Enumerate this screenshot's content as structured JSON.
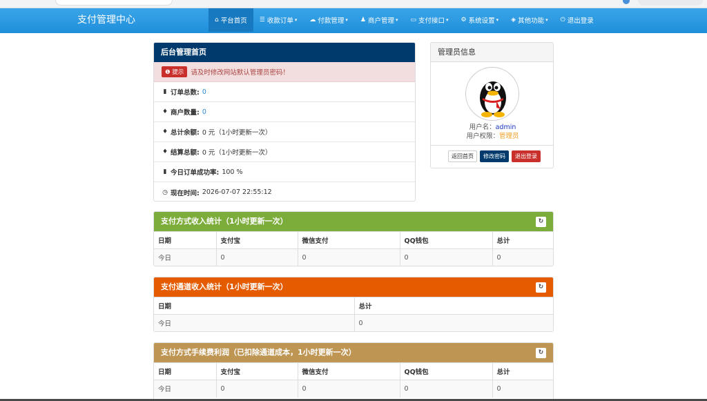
{
  "app": {
    "brand": "支付管理中心"
  },
  "nav": [
    {
      "label": "平台首页",
      "icon": "home-icon",
      "glyph": "⌂",
      "dropdown": false,
      "active": true
    },
    {
      "label": "收款订单",
      "icon": "list-icon",
      "glyph": "☰",
      "dropdown": true,
      "active": false
    },
    {
      "label": "付款管理",
      "icon": "cloud-icon",
      "glyph": "☁",
      "dropdown": true,
      "active": false
    },
    {
      "label": "商户管理",
      "icon": "user-icon",
      "glyph": "♟",
      "dropdown": true,
      "active": false
    },
    {
      "label": "支付接口",
      "icon": "credit-card-icon",
      "glyph": "▭",
      "dropdown": true,
      "active": false
    },
    {
      "label": "系统设置",
      "icon": "gear-icon",
      "glyph": "⚙",
      "dropdown": true,
      "active": false
    },
    {
      "label": "其他功能",
      "icon": "cube-icon",
      "glyph": "◈",
      "dropdown": true,
      "active": false
    },
    {
      "label": "退出登录",
      "icon": "power-icon",
      "glyph": "⏻",
      "dropdown": false,
      "active": false
    }
  ],
  "home_panel": {
    "title": "后台管理首页",
    "notice_badge": "提示",
    "notice_text": "请及时修改网站默认管理员密码！",
    "rows": [
      {
        "icon": "bar-chart-icon",
        "glyph": "▮",
        "label": "订单总数:",
        "value": "0",
        "link": true
      },
      {
        "icon": "drop-icon",
        "glyph": "♦",
        "label": "商户数量:",
        "value": "0",
        "link": true
      },
      {
        "icon": "drop-icon",
        "glyph": "♦",
        "label": "总计余额:",
        "value": "0 元（1小时更新一次）",
        "link": false
      },
      {
        "icon": "drop-icon",
        "glyph": "♦",
        "label": "结算总额:",
        "value": "0 元（1小时更新一次）",
        "link": false
      },
      {
        "icon": "bar-chart-icon",
        "glyph": "▮",
        "label": "今日订单成功率:",
        "value": "100 %",
        "link": false
      },
      {
        "icon": "clock-icon",
        "glyph": "◷",
        "label": "现在时间:",
        "value": "2026-07-07 22:55:12",
        "link": false
      }
    ]
  },
  "admin_panel": {
    "title": "管理员信息",
    "username_label": "用户名：",
    "username": "admin",
    "role_label": "用户权限：",
    "role": "管理员",
    "btn_home": "返回首页",
    "btn_password": "修改密码",
    "btn_logout": "退出登录"
  },
  "method_stats": {
    "title": "支付方式收入统计（1小时更新一次）",
    "headers": [
      "日期",
      "支付宝",
      "微信支付",
      "QQ钱包",
      "总计"
    ],
    "rows": [
      [
        "今日",
        "0",
        "0",
        "0",
        "0"
      ]
    ]
  },
  "channel_stats": {
    "title": "支付通道收入统计（1小时更新一次）",
    "headers": [
      "日期",
      "总计"
    ],
    "rows": [
      [
        "今日",
        "0"
      ]
    ]
  },
  "fee_stats": {
    "title": "支付方式手续费利润（已扣除通道成本，1小时更新一次）",
    "headers": [
      "日期",
      "支付宝",
      "微信支付",
      "QQ钱包",
      "总计"
    ],
    "rows": [
      [
        "今日",
        "0",
        "0",
        "0",
        "0"
      ]
    ]
  },
  "colors": {
    "navbar": "#2a9be3",
    "home_head": "#003a6c",
    "method_head": "#7cad3a",
    "channel_head": "#e55c00",
    "fee_head": "#bf9553"
  }
}
